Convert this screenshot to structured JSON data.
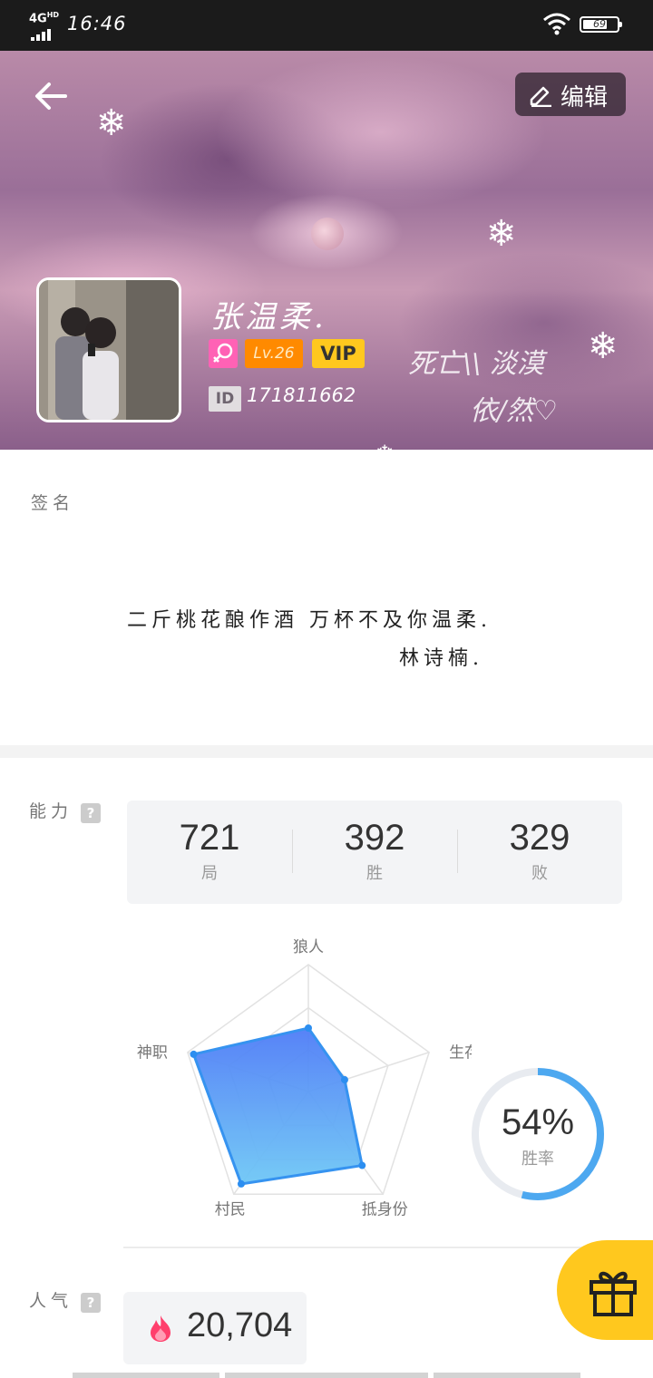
{
  "status_bar": {
    "network": "4G",
    "network_sup": "HD",
    "time": "16:46",
    "battery": "69"
  },
  "header": {
    "edit_label": "编辑",
    "nickname": "张温柔.",
    "level": "Lv.26",
    "vip": "VIP",
    "id_tag": "ID",
    "id_number": "171811662",
    "overlay_line1": "死亡\\\\ 淡漠",
    "overlay_line2": "依/然♡"
  },
  "signature": {
    "label": "签名",
    "line1": "二斤桃花酿作酒  万杯不及你温柔.",
    "line2": "林诗楠."
  },
  "ability": {
    "label": "能力",
    "help": "?",
    "stats": [
      {
        "value": "721",
        "label": "局"
      },
      {
        "value": "392",
        "label": "胜"
      },
      {
        "value": "329",
        "label": "败"
      }
    ],
    "radar_axes": [
      "狼人",
      "生存",
      "抵身份",
      "村民",
      "神职"
    ],
    "radar_values": [
      0.5,
      0.3,
      0.72,
      0.9,
      0.95
    ],
    "win_rate": "54%",
    "win_rate_value": 0.54,
    "win_rate_label": "胜率",
    "accent_color": "#4da8f0"
  },
  "popularity": {
    "label": "人气",
    "help": "?",
    "value": "20,704"
  },
  "icons": {
    "back": "back-arrow-icon",
    "edit": "edit-icon",
    "fire": "fire-icon",
    "gift": "gift-icon",
    "gender": "female-icon"
  }
}
